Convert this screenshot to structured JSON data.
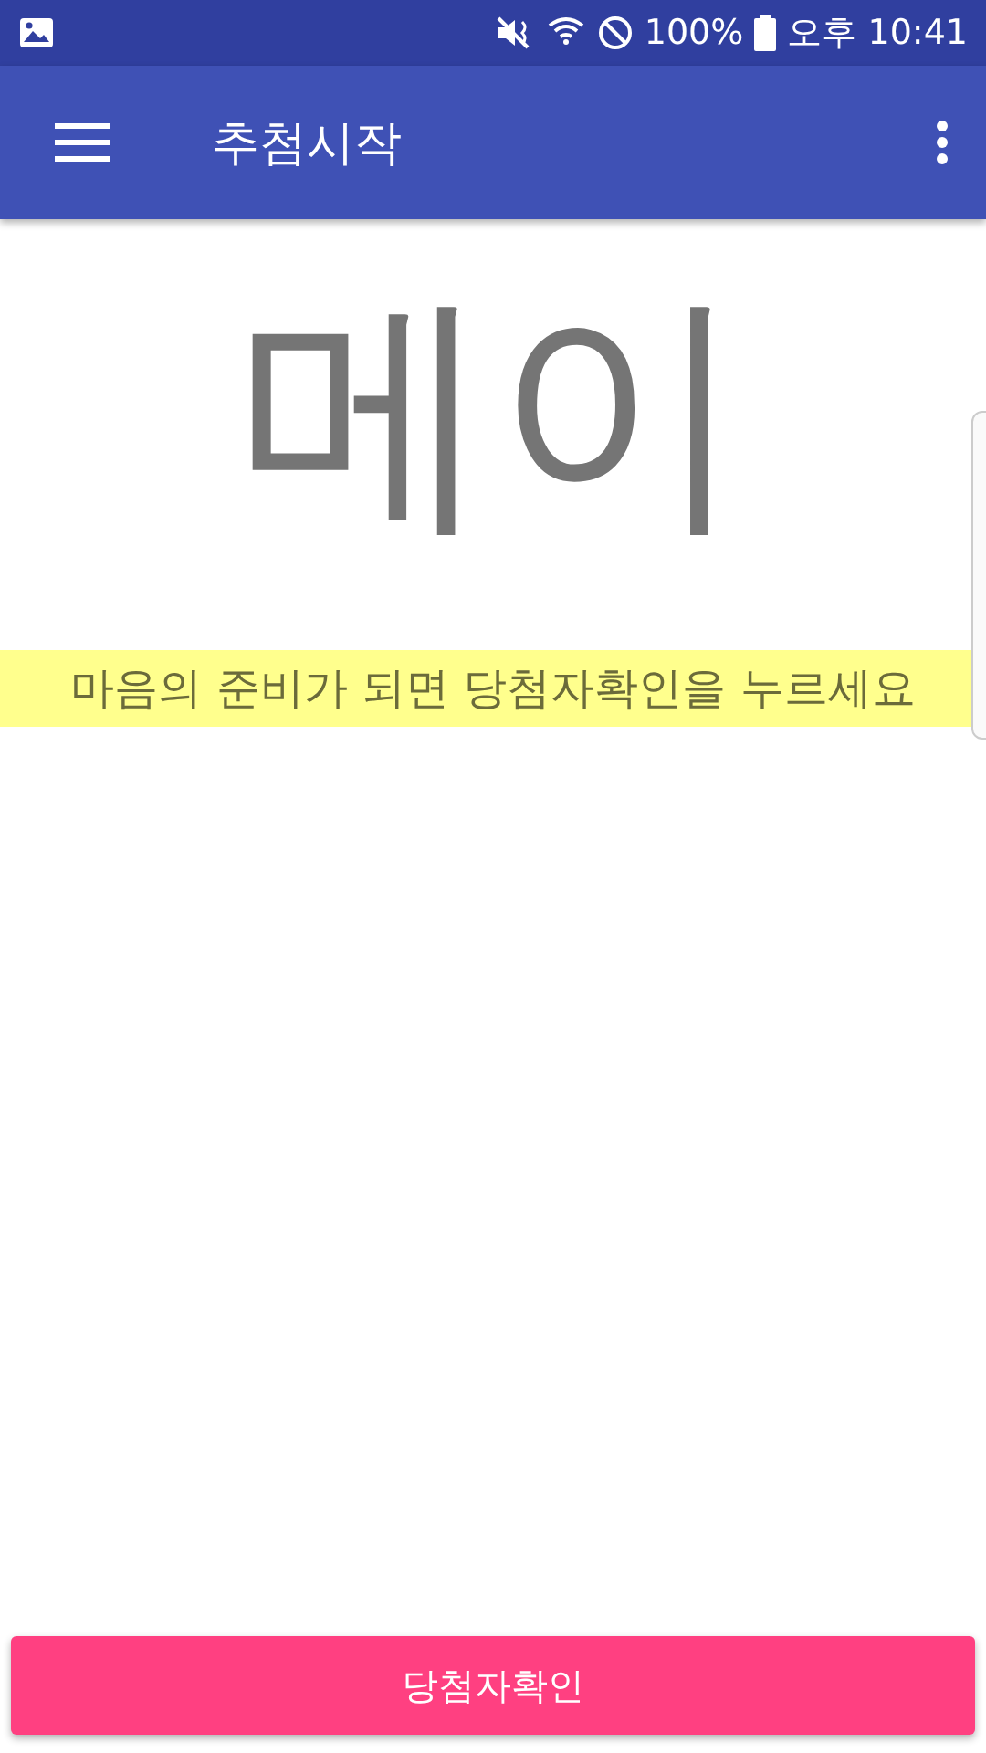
{
  "status_bar": {
    "battery": "100%",
    "time": "오후 10:41"
  },
  "toolbar": {
    "title": "추첨시작"
  },
  "winner": {
    "name": "메이"
  },
  "hint": "마음의 준비가 되면 당첨자확인을 누르세요",
  "button": {
    "label": "당첨자확인"
  }
}
